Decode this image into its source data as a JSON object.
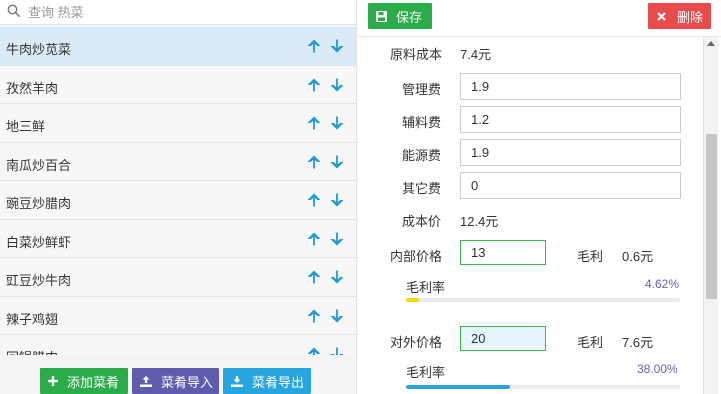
{
  "search": {
    "placeholder": "查询 热菜"
  },
  "dishes": [
    {
      "name": "牛肉炒苋菜",
      "active": true
    },
    {
      "name": "孜然羊肉",
      "active": false
    },
    {
      "name": "地三鲜",
      "active": false
    },
    {
      "name": "南瓜炒百合",
      "active": false
    },
    {
      "name": "豌豆炒腊肉",
      "active": false
    },
    {
      "name": "白菜炒鲜虾",
      "active": false
    },
    {
      "name": "豇豆炒牛肉",
      "active": false
    },
    {
      "name": "辣子鸡翅",
      "active": false
    },
    {
      "name": "回锅腊肉",
      "active": false
    }
  ],
  "actions": {
    "add": "添加菜肴",
    "import": "菜肴导入",
    "export": "菜肴导出"
  },
  "toolbar": {
    "save": "保存",
    "delete": "删除"
  },
  "form": {
    "raw_cost_label": "原料成本",
    "raw_cost_value": "7.4元",
    "management_fee_label": "管理费",
    "management_fee_value": "1.9",
    "auxiliary_fee_label": "辅料费",
    "auxiliary_fee_value": "1.2",
    "energy_fee_label": "能源费",
    "energy_fee_value": "1.9",
    "other_fee_label": "其它费",
    "other_fee_value": "0",
    "cost_price_label": "成本价",
    "cost_price_value": "12.4元",
    "internal_price_label": "内部价格",
    "internal_price_value": "13",
    "internal_profit_label": "毛利",
    "internal_profit_value": "0.6元",
    "internal_margin_label": "毛利率",
    "internal_margin_value": "4.62%",
    "internal_margin_fraction": 0.0462,
    "external_price_label": "对外价格",
    "external_price_value": "20",
    "external_profit_label": "毛利",
    "external_profit_value": "7.6元",
    "external_margin_label": "毛利率",
    "external_margin_value": "38.00%",
    "external_margin_fraction": 0.38
  },
  "colors": {
    "green": "#2bab4a",
    "purple": "#5f5cad",
    "blue": "#27a5de",
    "red": "#e84b4b",
    "arrow": "#1e9ad6",
    "margin_low": "#f5d90a",
    "margin_high": "#27a5de",
    "active_row": "#dbeaf7"
  }
}
